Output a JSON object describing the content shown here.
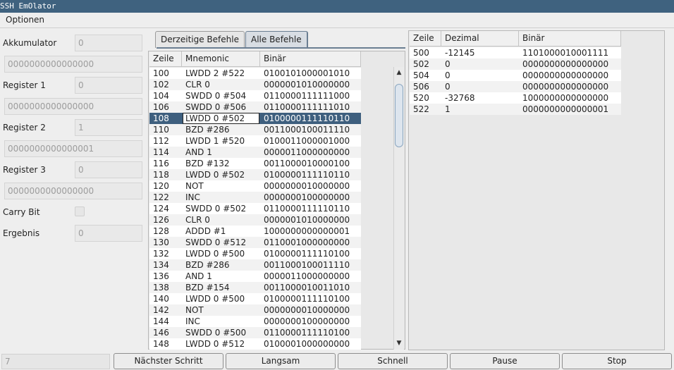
{
  "window": {
    "title": "SSH EmOlator"
  },
  "menu": {
    "options_label": "Optionen"
  },
  "registers": {
    "akkumulator": {
      "label": "Akkumulator",
      "value": "0",
      "binary": "0000000000000000"
    },
    "register1": {
      "label": "Register 1",
      "value": "0",
      "binary": "0000000000000000"
    },
    "register2": {
      "label": "Register 2",
      "value": "1",
      "binary": "0000000000000001"
    },
    "register3": {
      "label": "Register 3",
      "value": "0",
      "binary": "0000000000000000"
    },
    "carry": {
      "label": "Carry Bit",
      "checked": false
    },
    "ergebnis": {
      "label": "Ergebnis",
      "value": "0"
    }
  },
  "tabs": [
    {
      "label": "Derzeitige Befehle",
      "active": false
    },
    {
      "label": "Alle Befehle",
      "active": true
    }
  ],
  "program_table": {
    "headers": [
      "Zeile",
      "Mnemonic",
      "Binär"
    ],
    "selected_index": 4,
    "rows": [
      [
        "100",
        "LWDD 2 #522",
        "0100101000001010"
      ],
      [
        "102",
        "CLR 0",
        "0000001010000000"
      ],
      [
        "104",
        "SWDD 0 #504",
        "0110000111111000"
      ],
      [
        "106",
        "SWDD 0 #506",
        "0110000111111010"
      ],
      [
        "108",
        "LWDD 0 #502",
        "0100000111110110"
      ],
      [
        "110",
        "BZD #286",
        "0011000100011110"
      ],
      [
        "112",
        "LWDD 1 #520",
        "0100011000001000"
      ],
      [
        "114",
        "AND 1",
        "0000011000000000"
      ],
      [
        "116",
        "BZD #132",
        "0011000010000100"
      ],
      [
        "118",
        "LWDD 0 #502",
        "0100000111110110"
      ],
      [
        "120",
        "NOT",
        "0000000010000000"
      ],
      [
        "122",
        "INC",
        "0000000100000000"
      ],
      [
        "124",
        "SWDD 0 #502",
        "0110000111110110"
      ],
      [
        "126",
        "CLR 0",
        "0000001010000000"
      ],
      [
        "128",
        "ADDD #1",
        "1000000000000001"
      ],
      [
        "130",
        "SWDD 0 #512",
        "0110001000000000"
      ],
      [
        "132",
        "LWDD 0 #500",
        "0100000111110100"
      ],
      [
        "134",
        "BZD #286",
        "0011000100011110"
      ],
      [
        "136",
        "AND 1",
        "0000011000000000"
      ],
      [
        "138",
        "BZD #154",
        "0011000010011010"
      ],
      [
        "140",
        "LWDD 0 #500",
        "0100000111110100"
      ],
      [
        "142",
        "NOT",
        "0000000010000000"
      ],
      [
        "144",
        "INC",
        "0000000100000000"
      ],
      [
        "146",
        "SWDD 0 #500",
        "0110000111110100"
      ],
      [
        "148",
        "LWDD 0 #512",
        "0100001000000000"
      ]
    ]
  },
  "memory_table": {
    "headers": [
      "Zeile",
      "Dezimal",
      "Binär"
    ],
    "rows": [
      [
        "500",
        "-12145",
        "1101000010001111"
      ],
      [
        "502",
        "0",
        "0000000000000000"
      ],
      [
        "504",
        "0",
        "0000000000000000"
      ],
      [
        "506",
        "0",
        "0000000000000000"
      ],
      [
        "520",
        "-32768",
        "1000000000000000"
      ],
      [
        "522",
        "1",
        "0000000000000001"
      ]
    ]
  },
  "status": {
    "value": "7"
  },
  "buttons": {
    "next_step": "Nächster Schritt",
    "slow": "Langsam",
    "fast": "Schnell",
    "pause": "Pause",
    "stop": "Stop"
  },
  "scrollbar": {
    "up_arrow": "▲",
    "down_arrow": "▼"
  }
}
